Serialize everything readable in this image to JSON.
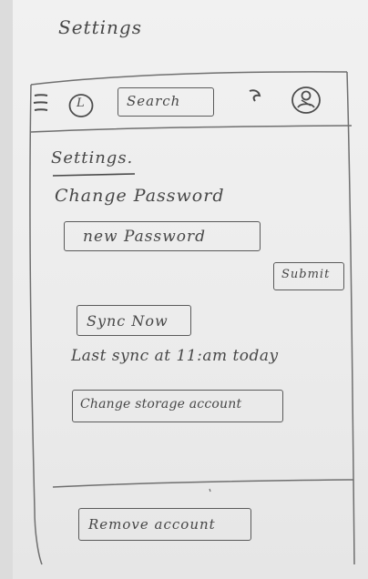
{
  "page_title": "Settings",
  "topbar": {
    "menu_icon": "hamburger-menu-icon",
    "logo_text": "L",
    "search_label": "Search",
    "refresh_icon": "refresh-arrow-icon",
    "profile_icon": "user-avatar-icon"
  },
  "settings": {
    "heading": "Settings.",
    "change_password_label": "Change Password",
    "new_password_placeholder": "new Password",
    "submit_label": "Submit",
    "sync_now_label": "Sync Now",
    "last_sync_text": "Last sync at 11:am today",
    "change_storage_label": "Change storage account"
  },
  "footer": {
    "remove_account_label": "Remove account"
  }
}
